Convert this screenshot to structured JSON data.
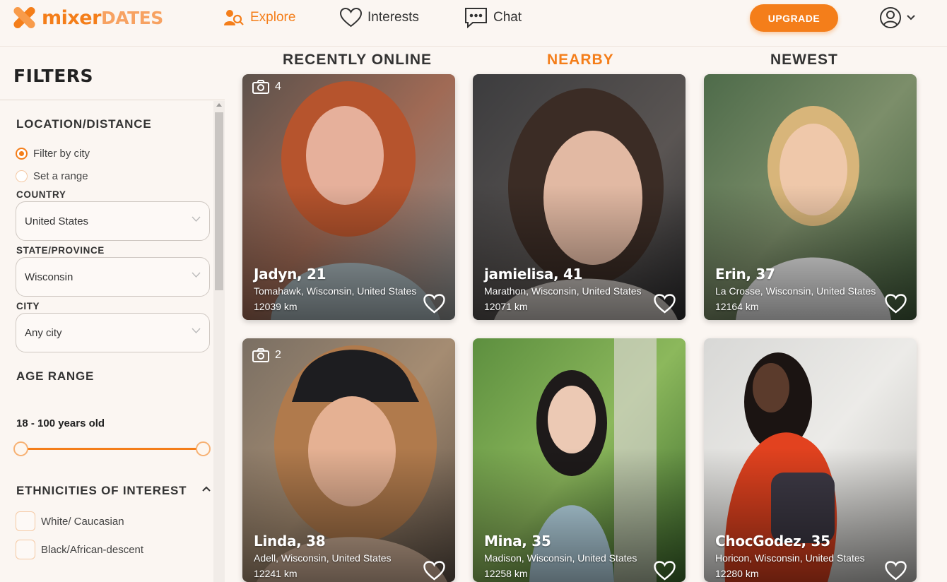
{
  "brand": {
    "part1": "mixer",
    "part2": "DATES"
  },
  "nav": {
    "explore": "Explore",
    "interests": "Interests",
    "chat": "Chat",
    "upgrade": "UPGRADE"
  },
  "sidebar": {
    "title": "FILTERS",
    "location_title": "LOCATION/DISTANCE",
    "radio_city": "Filter by city",
    "radio_range": "Set a range",
    "country_label": "COUNTRY",
    "country_value": "United States",
    "state_label": "STATE/PROVINCE",
    "state_value": "Wisconsin",
    "city_label": "CITY",
    "city_value": "Any city",
    "age_title": "AGE RANGE",
    "age_value": "18 - 100 years old",
    "ethnicities_title": "ETHNICITIES OF INTEREST",
    "eth_1": "White/ Caucasian",
    "eth_2": "Black/African-descent"
  },
  "tabs": {
    "recent": "RECENTLY ONLINE",
    "nearby": "NEARBY",
    "newest": "NEWEST"
  },
  "accent_color": "#f47e1a",
  "profiles": [
    {
      "name": "Jadyn, 21",
      "location": "Tomahawk, Wisconsin, United States",
      "distance": "12039 km",
      "photos": "4"
    },
    {
      "name": "jamielisa, 41",
      "location": "Marathon, Wisconsin, United States",
      "distance": "12071 km",
      "photos": ""
    },
    {
      "name": "Erin, 37",
      "location": "La Crosse, Wisconsin, United States",
      "distance": "12164 km",
      "photos": ""
    },
    {
      "name": "Linda, 38",
      "location": "Adell, Wisconsin, United States",
      "distance": "12241 km",
      "photos": "2"
    },
    {
      "name": "Mina, 35",
      "location": "Madison, Wisconsin, United States",
      "distance": "12258 km",
      "photos": ""
    },
    {
      "name": "ChocGodez, 35",
      "location": "Horicon, Wisconsin, United States",
      "distance": "12280 km",
      "photos": ""
    }
  ]
}
